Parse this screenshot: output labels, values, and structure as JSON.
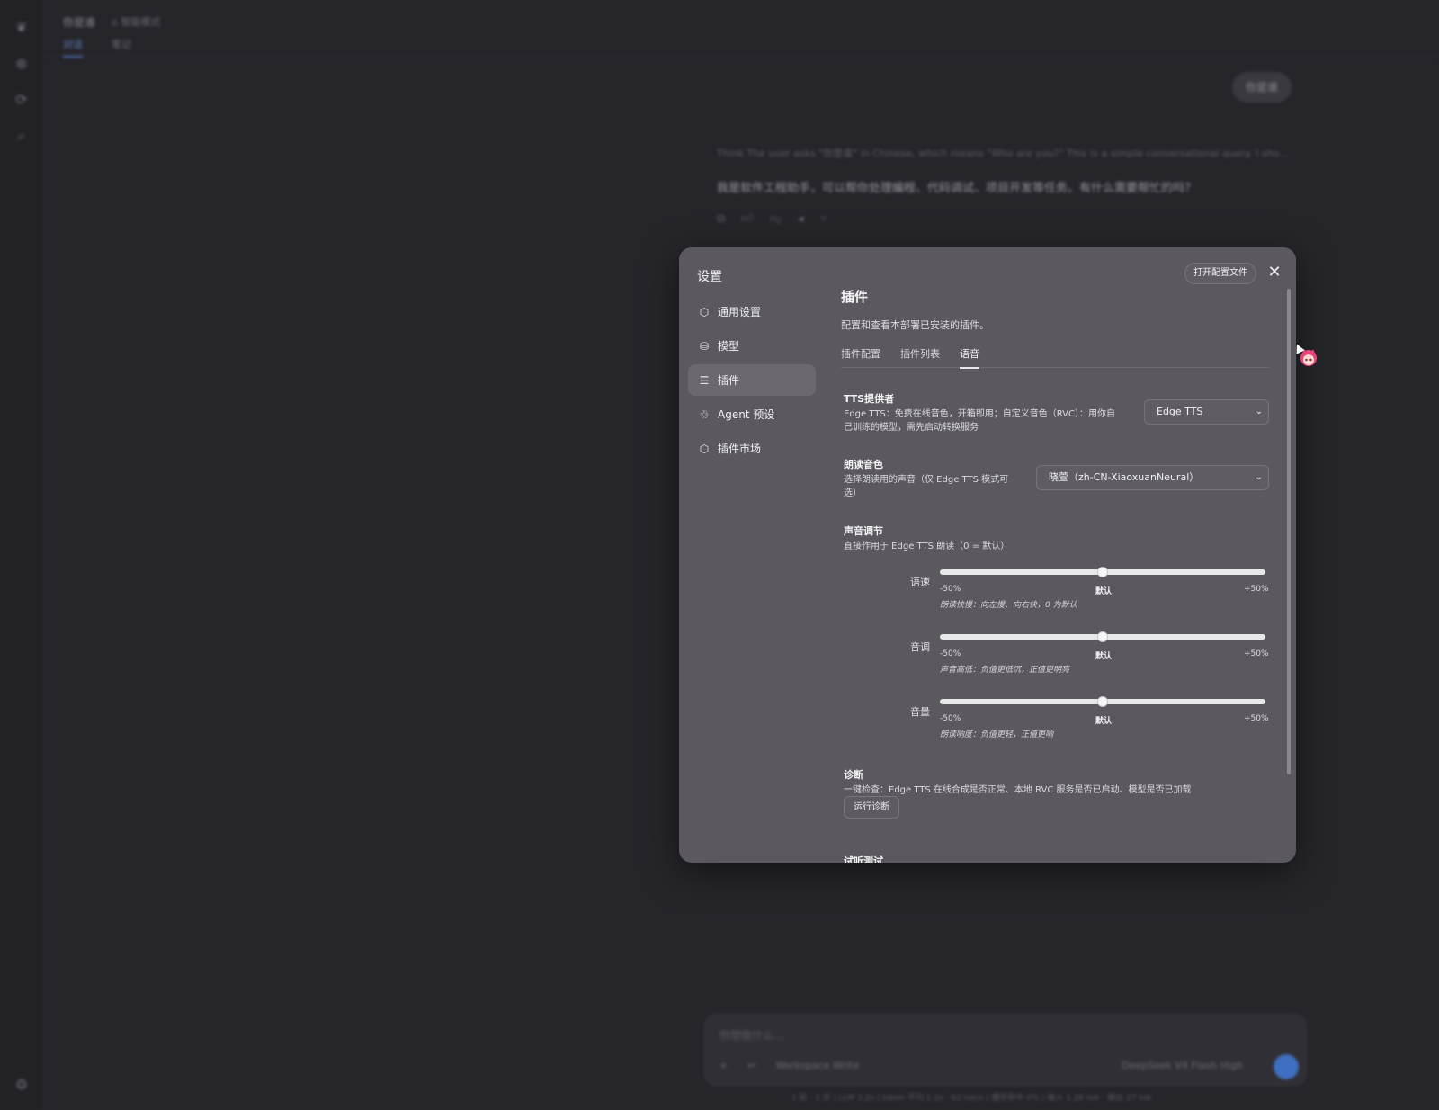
{
  "background": {
    "conversation_title": "你是谁",
    "conversation_mode": "⌂ 智能模式",
    "tabs": [
      "对话",
      "笔记"
    ],
    "user_bubble": "你是谁",
    "think_text": "Think   The user asks \"你是谁\" in Chinese, which means \"Who are you?\" This is a simple conversational query. I sho...",
    "reply_text": "我是软件工程助手，可以帮你处理编程、代码调试、项目开发等任务。有什么需要帮忙的吗？",
    "composer_placeholder": "你想做什么...",
    "composer_workspace": "Workspace Write",
    "composer_model": "DeepSeek V4 Flash  High",
    "status_line": "1 轮 · 1 步  |  LLM 3.2s  |  token 平均 1.2s · 62 tok/s  |  缓存命中 0%  |  输入 1.2K tok · 输出 27 tok"
  },
  "modal": {
    "title": "设置",
    "open_config_label": "打开配置文件",
    "close_label": "✕",
    "nav": [
      {
        "label": "通用设置",
        "icon": "gear-icon"
      },
      {
        "label": "模型",
        "icon": "database-icon"
      },
      {
        "label": "插件",
        "icon": "sliders-icon"
      },
      {
        "label": "Agent 预设",
        "icon": "agent-icon"
      },
      {
        "label": "插件市场",
        "icon": "market-icon"
      }
    ],
    "active_nav": "插件",
    "heading": "插件",
    "subheading": "配置和查看本部署已安装的插件。",
    "tabs": [
      "插件配置",
      "插件列表",
      "语音"
    ],
    "active_tab": "语音",
    "tts": {
      "title": "TTS提供者",
      "desc_line1": "Edge TTS：免费在线音色，开箱即用；自定义音色（RVC）：用你自",
      "desc_line2": "己训练的模型，需先启动转换服务",
      "value": "Edge TTS"
    },
    "voice": {
      "title": "朗读音色",
      "desc_line1": "选择朗读用的声音（仅 Edge TTS 模式可",
      "desc_line2": "选）",
      "value": "晓萱（zh-CN-XiaoxuanNeural）"
    },
    "adjust": {
      "title": "声音调节",
      "desc": "直接作用于 Edge TTS 朗读（0 = 默认）",
      "sliders": [
        {
          "label": "语速",
          "min": "-50%",
          "mid": "默认",
          "max": "+50%",
          "hint": "朗读快慢：向左慢、向右快，0 为默认",
          "value": 0
        },
        {
          "label": "音调",
          "min": "-50%",
          "mid": "默认",
          "max": "+50%",
          "hint": "声音高低：负值更低沉，正值更明亮",
          "value": 0
        },
        {
          "label": "音量",
          "min": "-50%",
          "mid": "默认",
          "max": "+50%",
          "hint": "朗读响度：负值更轻，正值更响",
          "value": 0
        }
      ]
    },
    "diag": {
      "title": "诊断",
      "desc": "一键检查：Edge TTS 在线合成是否正常、本地 RVC 服务是否已启动、模型是否已加载",
      "button": "运行诊断"
    },
    "trial_title": "试听测试"
  }
}
